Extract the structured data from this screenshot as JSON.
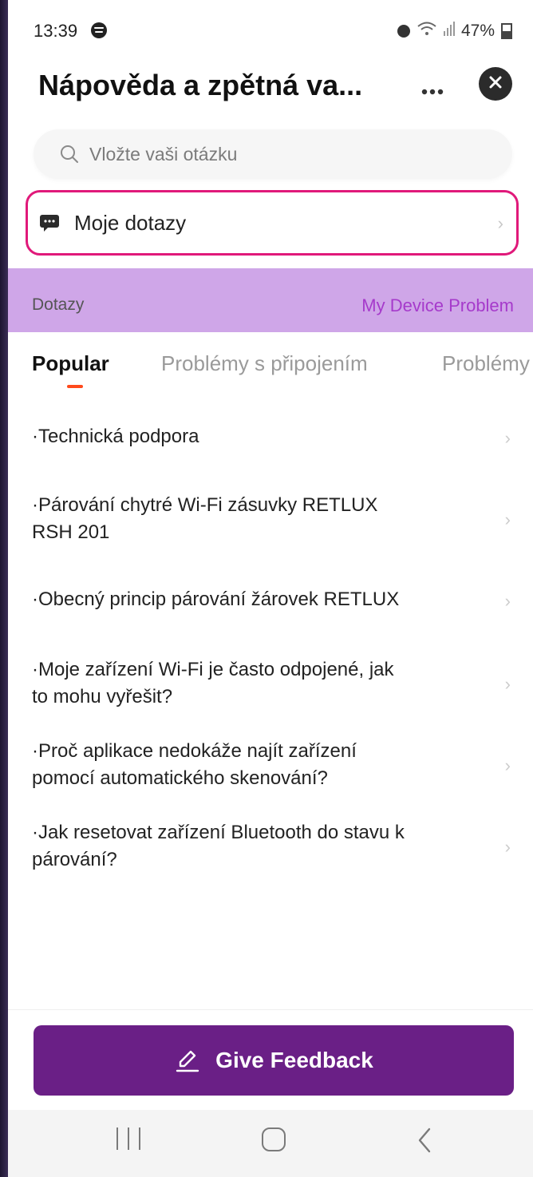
{
  "status_bar": {
    "time": "13:39",
    "battery": "47%",
    "icons": [
      "spotify-icon",
      "alarm-icon",
      "wifi-icon",
      "signal-icon",
      "battery-icon"
    ]
  },
  "header": {
    "title": "Nápověda a zpětná va...",
    "more_icon": "more-icon",
    "close_icon": "close-icon"
  },
  "search": {
    "placeholder": "Vložte vaši otázku",
    "icon": "search-icon"
  },
  "my_queries": {
    "label": "Moje dotazy",
    "icon": "chat-icon",
    "highlight_color": "#e0197a"
  },
  "section_band": {
    "left_label": "Dotazy",
    "right_label": "My Device Problem",
    "background": "#cfa6e8",
    "accent": "#a63acb"
  },
  "tabs": [
    {
      "label": "Popular",
      "active": true
    },
    {
      "label": "Problémy s připojením",
      "active": false
    },
    {
      "label": "Problémy",
      "active": false
    }
  ],
  "faq_items": [
    {
      "lines": [
        "·Technická podpora"
      ]
    },
    {
      "lines": [
        "·Párování chytré Wi-Fi zásuvky RETLUX",
        "RSH 201"
      ]
    },
    {
      "lines": [
        "·Obecný princip párování žárovek RETLUX"
      ]
    },
    {
      "lines": [
        "·Moje zařízení Wi-Fi je často odpojené, jak",
        "to mohu vyřešit?"
      ]
    },
    {
      "lines": [
        "·Proč aplikace nedokáže najít zařízení",
        "pomocí automatického skenování?"
      ]
    },
    {
      "lines": [
        "·Jak resetovat zařízení Bluetooth do stavu k",
        "párování?"
      ]
    }
  ],
  "feedback_button": {
    "label": "Give Feedback",
    "icon": "pencil-icon",
    "color": "#6a1f86"
  },
  "nav_bar": {
    "icons": [
      "recents-icon",
      "home-icon",
      "back-icon"
    ]
  }
}
